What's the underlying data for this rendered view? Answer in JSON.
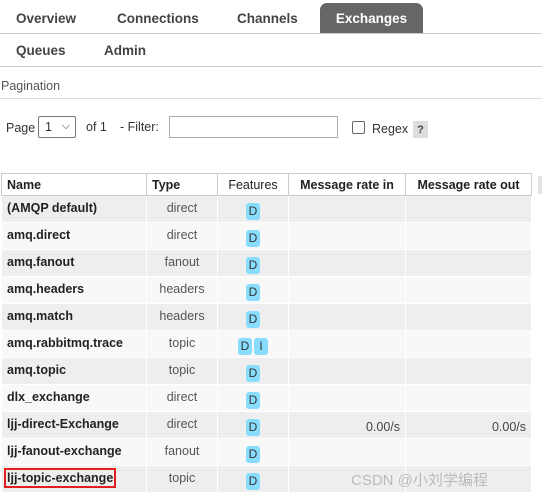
{
  "nav": {
    "tabs": [
      {
        "label": "Overview",
        "active": false
      },
      {
        "label": "Connections",
        "active": false
      },
      {
        "label": "Channels",
        "active": false
      },
      {
        "label": "Exchanges",
        "active": true
      },
      {
        "label": "Queues",
        "active": false
      },
      {
        "label": "Admin",
        "active": false
      }
    ]
  },
  "pagination": {
    "title": "Pagination",
    "page_label": "Page",
    "page_value": "1",
    "of_label": "of 1",
    "filter_label": "- Filter:",
    "filter_value": "",
    "regex_label": "Regex",
    "help_label": "?"
  },
  "table": {
    "headers": [
      "Name",
      "Type",
      "Features",
      "Message rate in",
      "Message rate out"
    ],
    "rows": [
      {
        "name": "(AMQP default)",
        "type": "direct",
        "features": [
          "D"
        ],
        "rate_in": "",
        "rate_out": ""
      },
      {
        "name": "amq.direct",
        "type": "direct",
        "features": [
          "D"
        ],
        "rate_in": "",
        "rate_out": ""
      },
      {
        "name": "amq.fanout",
        "type": "fanout",
        "features": [
          "D"
        ],
        "rate_in": "",
        "rate_out": ""
      },
      {
        "name": "amq.headers",
        "type": "headers",
        "features": [
          "D"
        ],
        "rate_in": "",
        "rate_out": ""
      },
      {
        "name": "amq.match",
        "type": "headers",
        "features": [
          "D"
        ],
        "rate_in": "",
        "rate_out": ""
      },
      {
        "name": "amq.rabbitmq.trace",
        "type": "topic",
        "features": [
          "D",
          "I"
        ],
        "rate_in": "",
        "rate_out": ""
      },
      {
        "name": "amq.topic",
        "type": "topic",
        "features": [
          "D"
        ],
        "rate_in": "",
        "rate_out": ""
      },
      {
        "name": "dlx_exchange",
        "type": "direct",
        "features": [
          "D"
        ],
        "rate_in": "",
        "rate_out": ""
      },
      {
        "name": "ljj-direct-Exchange",
        "type": "direct",
        "features": [
          "D"
        ],
        "rate_in": "0.00/s",
        "rate_out": "0.00/s"
      },
      {
        "name": "ljj-fanout-exchange",
        "type": "fanout",
        "features": [
          "D"
        ],
        "rate_in": "",
        "rate_out": ""
      },
      {
        "name": "ljj-topic-exchange",
        "type": "topic",
        "features": [
          "D"
        ],
        "rate_in": "",
        "rate_out": "",
        "highlighted": true
      }
    ]
  },
  "watermark": "CSDN @小刘学编程",
  "colors": {
    "active_tab": "#666666",
    "badge": "#88ddff",
    "highlight": "#e02020"
  }
}
